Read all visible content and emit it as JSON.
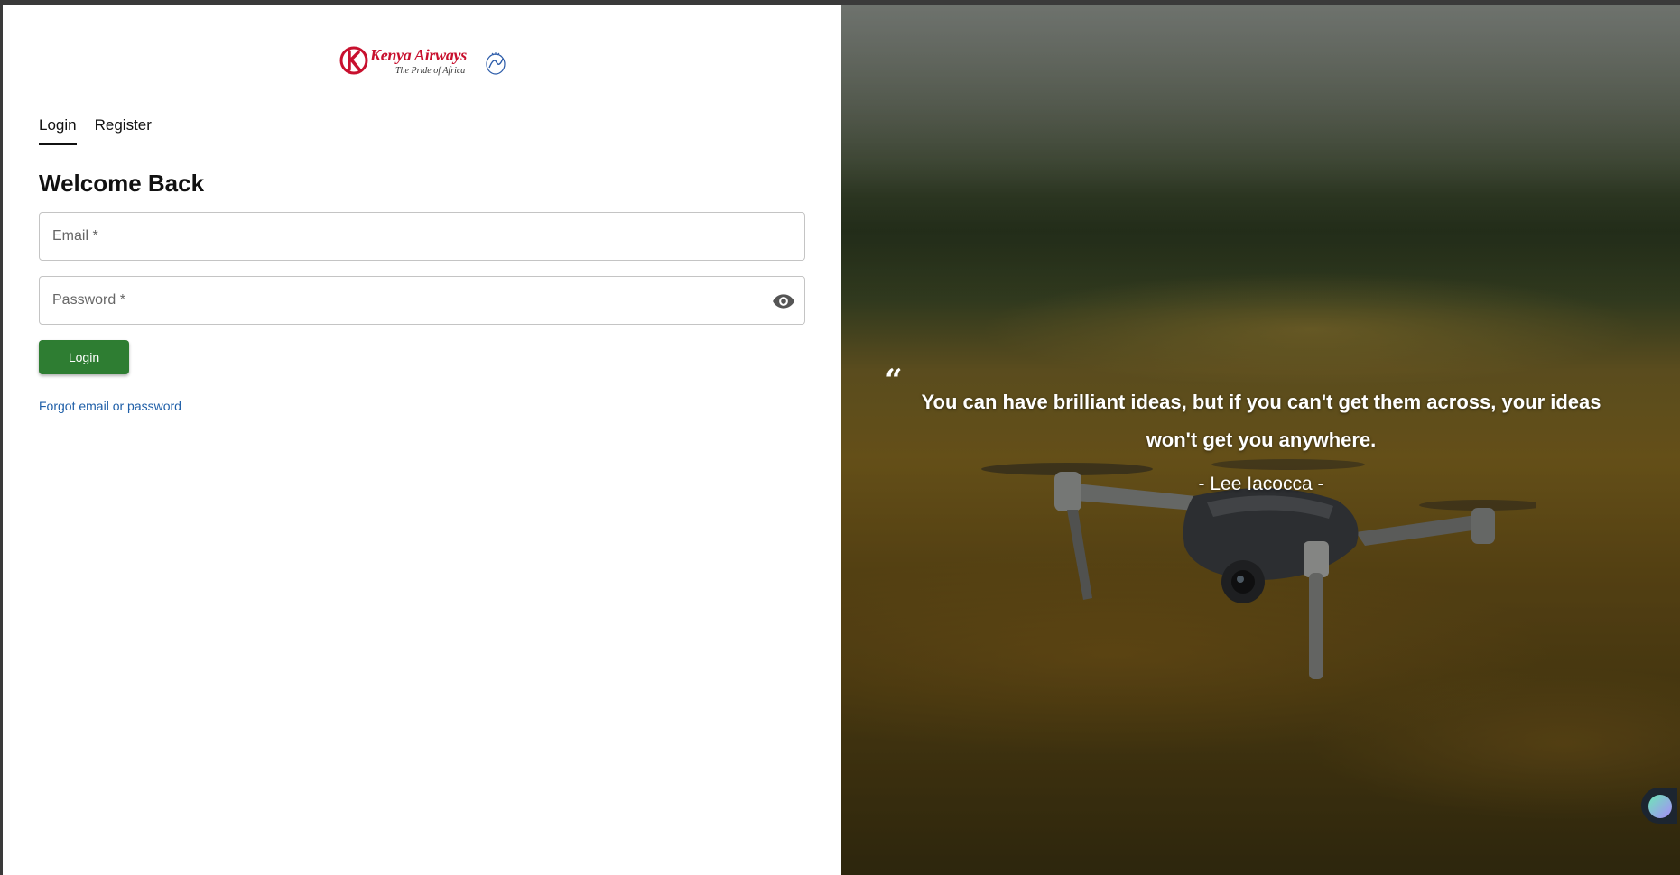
{
  "brand": {
    "name": "Kenya Airways",
    "tagline": "The Pride of Africa",
    "accent_color": "#c8102e"
  },
  "tabs": [
    {
      "label": "Login",
      "active": true
    },
    {
      "label": "Register",
      "active": false
    }
  ],
  "form": {
    "heading": "Welcome Back",
    "email_placeholder": "Email *",
    "email_value": "",
    "password_placeholder": "Password *",
    "password_value": "",
    "password_toggle_icon": "eye-icon",
    "submit_label": "Login",
    "submit_color": "#2e7d32",
    "forgot_label": "Forgot email or password"
  },
  "quote": {
    "mark": "“",
    "text": "You can have brilliant ideas, but if you can't get them across, your ideas won't get you anywhere.",
    "author": "- Lee Iacocca -"
  },
  "help_widget": {
    "icon": "chat-widget-icon"
  }
}
